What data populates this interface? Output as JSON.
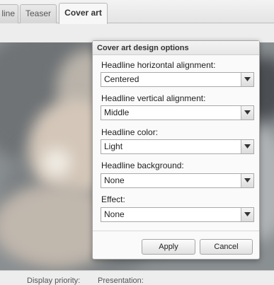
{
  "tabs": [
    {
      "label": "line"
    },
    {
      "label": "Teaser"
    },
    {
      "label": "Cover art",
      "active": true
    }
  ],
  "dialog": {
    "title": "Cover art design options",
    "fields": [
      {
        "label": "Headline horizontal alignment:",
        "value": "Centered"
      },
      {
        "label": "Headline vertical alignment:",
        "value": "Middle"
      },
      {
        "label": "Headline color:",
        "value": "Light"
      },
      {
        "label": "Headline background:",
        "value": "None"
      },
      {
        "label": "Effect:",
        "value": "None"
      }
    ],
    "buttons": {
      "apply": "Apply",
      "cancel": "Cancel"
    }
  },
  "footer": {
    "display_priority": "Display priority:",
    "presentation": "Presentation:"
  },
  "icons": {
    "dropdown": "chevron-down-icon"
  },
  "colors": {
    "dialog_background": "#fafafa",
    "dialog_border": "#a7a7a7",
    "cover_tone": "#8a8f92"
  }
}
